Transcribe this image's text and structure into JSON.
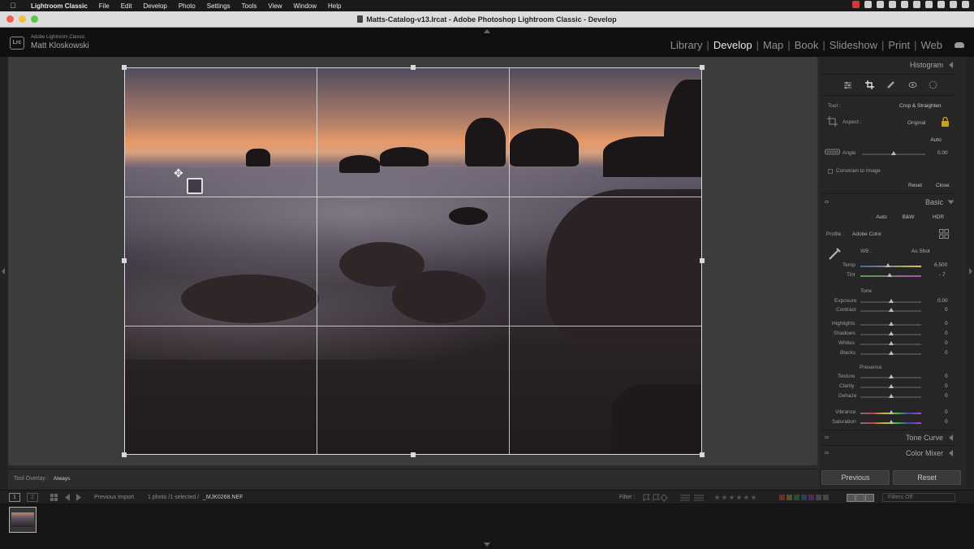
{
  "menubar": {
    "app": "Lightroom Classic",
    "items": [
      "File",
      "Edit",
      "Develop",
      "Photo",
      "Settings",
      "Tools",
      "View",
      "Window",
      "Help"
    ]
  },
  "window": {
    "title": "Matts-Catalog-v13.lrcat - Adobe Photoshop Lightroom Classic - Develop"
  },
  "identity": {
    "product": "Adobe Lightroom Classic",
    "user": "Matt Kloskowski",
    "logo": "Lrc"
  },
  "modules": {
    "items": [
      "Library",
      "Develop",
      "Map",
      "Book",
      "Slideshow",
      "Print",
      "Web"
    ],
    "active": "Develop",
    "sep": "|"
  },
  "toolbar": {
    "overlay_label": "Tool Overlay :",
    "overlay_value": "Always"
  },
  "panels": {
    "histogram": "Histogram",
    "crop": {
      "tool_label": "Tool :",
      "tool_value": "Crop & Straighten",
      "aspect_label": "Aspect :",
      "aspect_value": "Original",
      "auto": "Auto",
      "angle_label": "Angle",
      "angle_value": "0.00",
      "constrain": "Constrain to Image",
      "reset": "Reset",
      "close": "Close"
    },
    "basic": {
      "title": "Basic",
      "treatments": [
        "Auto",
        "B&W",
        "HDR"
      ],
      "profile_label": "Profile :",
      "profile_value": "Adobe Color",
      "wb_label": "WB :",
      "wb_value": "As Shot",
      "temp_label": "Temp",
      "temp_value": "6,500",
      "tint_label": "Tint",
      "tint_value": "- 7",
      "tone_header": "Tone",
      "exposure_label": "Exposure",
      "exposure_value": "0.00",
      "contrast_label": "Contrast",
      "contrast_value": "0",
      "highlights_label": "Highlights",
      "highlights_value": "0",
      "shadows_label": "Shadows",
      "shadows_value": "0",
      "whites_label": "Whites",
      "whites_value": "0",
      "blacks_label": "Blacks",
      "blacks_value": "0",
      "presence_header": "Presence",
      "texture_label": "Texture",
      "texture_value": "0",
      "clarity_label": "Clarity",
      "clarity_value": "0",
      "dehaze_label": "Dehaze",
      "dehaze_value": "0",
      "vibrance_label": "Vibrance",
      "vibrance_value": "0",
      "saturation_label": "Saturation",
      "saturation_value": "0"
    },
    "tone_curve": "Tone Curve",
    "color_mixer": "Color Mixer"
  },
  "bottom_buttons": {
    "previous": "Previous",
    "reset": "Reset"
  },
  "filmbar": {
    "page1": "1",
    "page2": "2",
    "source": "Previous Import",
    "count": "1 photo /1 selected /",
    "filename": "_MJK0268.NEF",
    "filter_label": "Filter :",
    "filters_off": "Filters Off"
  }
}
